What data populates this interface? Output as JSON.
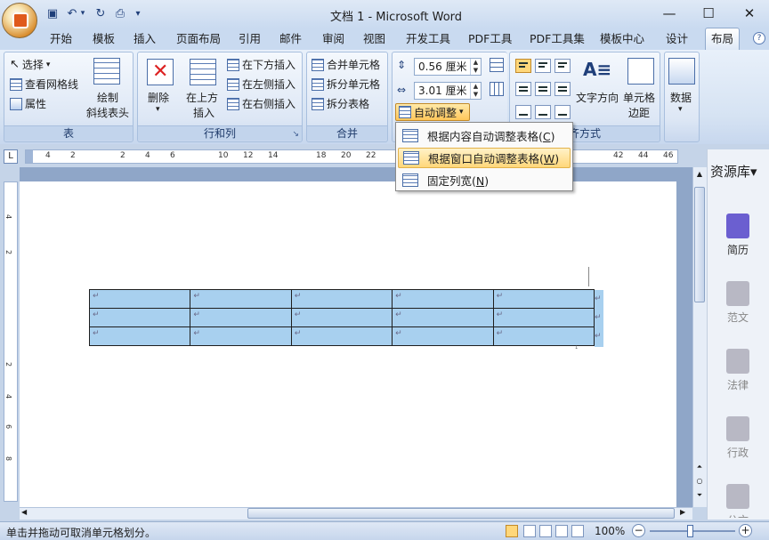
{
  "window": {
    "title": "文档 1 - Microsoft Word"
  },
  "qat": {
    "save": "save-icon",
    "undo": "undo-icon",
    "undo_menu": "▾",
    "redo": "redo-icon",
    "print": "print-icon",
    "customize": "▾"
  },
  "tabs": [
    "开始",
    "模板",
    "插入",
    "页面布局",
    "引用",
    "邮件",
    "审阅",
    "视图",
    "开发工具",
    "PDF工具",
    "PDF工具集",
    "模板中心",
    "设计",
    "布局"
  ],
  "active_tab": "布局",
  "ribbon": {
    "table_group": {
      "label": "表",
      "select": "选择",
      "select_arrow": "▾",
      "gridlines": "查看网格线",
      "properties": "属性",
      "draw_diag_1": "绘制",
      "draw_diag_2": "斜线表头"
    },
    "rows_cols_group": {
      "label": "行和列",
      "delete": "删除",
      "delete_arrow": "▾",
      "insert_above_1": "在上方",
      "insert_above_2": "插入",
      "insert_below": "在下方插入",
      "insert_left": "在左侧插入",
      "insert_right": "在右侧插入",
      "launcher": "↘"
    },
    "merge_group": {
      "label": "合并",
      "merge_cells": "合并单元格",
      "split_cells": "拆分单元格",
      "split_table": "拆分表格"
    },
    "cell_size_group": {
      "height": "0.56 厘米",
      "width": "3.01 厘米",
      "autofit": "自动调整",
      "autofit_arrow": "▾"
    },
    "alignment_group": {
      "label": "对齐方式",
      "label_visible": "齐方式",
      "text_direction": "文字方向",
      "cell_margins_1": "单元格",
      "cell_margins_2": "边距"
    },
    "data_group": {
      "data": "数据",
      "arrow": "▾"
    }
  },
  "autofit_menu": [
    {
      "label": "根据内容自动调整表格(C)",
      "text": "根据内容自动调整表格(",
      "key": "C",
      "hover": false
    },
    {
      "label": "根据窗口自动调整表格(W)",
      "text": "根据窗口自动调整表格(",
      "key": "W",
      "hover": true
    },
    {
      "label": "固定列宽(N)",
      "text": "固定列宽(",
      "key": "N",
      "hover": false
    }
  ],
  "ruler": {
    "labels": [
      "4",
      "2",
      "2",
      "4",
      "6",
      "10",
      "12",
      "14",
      "18",
      "20",
      "22",
      "42",
      "44",
      "46"
    ]
  },
  "vruler": {
    "labels": [
      "4",
      "2",
      "2",
      "4",
      "6",
      "8"
    ]
  },
  "document": {
    "table_rows": 3,
    "table_cols": 5,
    "cell_mark": "↵"
  },
  "side_panel": {
    "title": "资源库▾",
    "items": [
      "简历",
      "范文",
      "法律",
      "行政",
      "公文"
    ]
  },
  "statusbar": {
    "message": "单击并拖动可取消单元格划分。",
    "zoom": "100%",
    "zoom_minus": "−",
    "zoom_plus": "+"
  }
}
